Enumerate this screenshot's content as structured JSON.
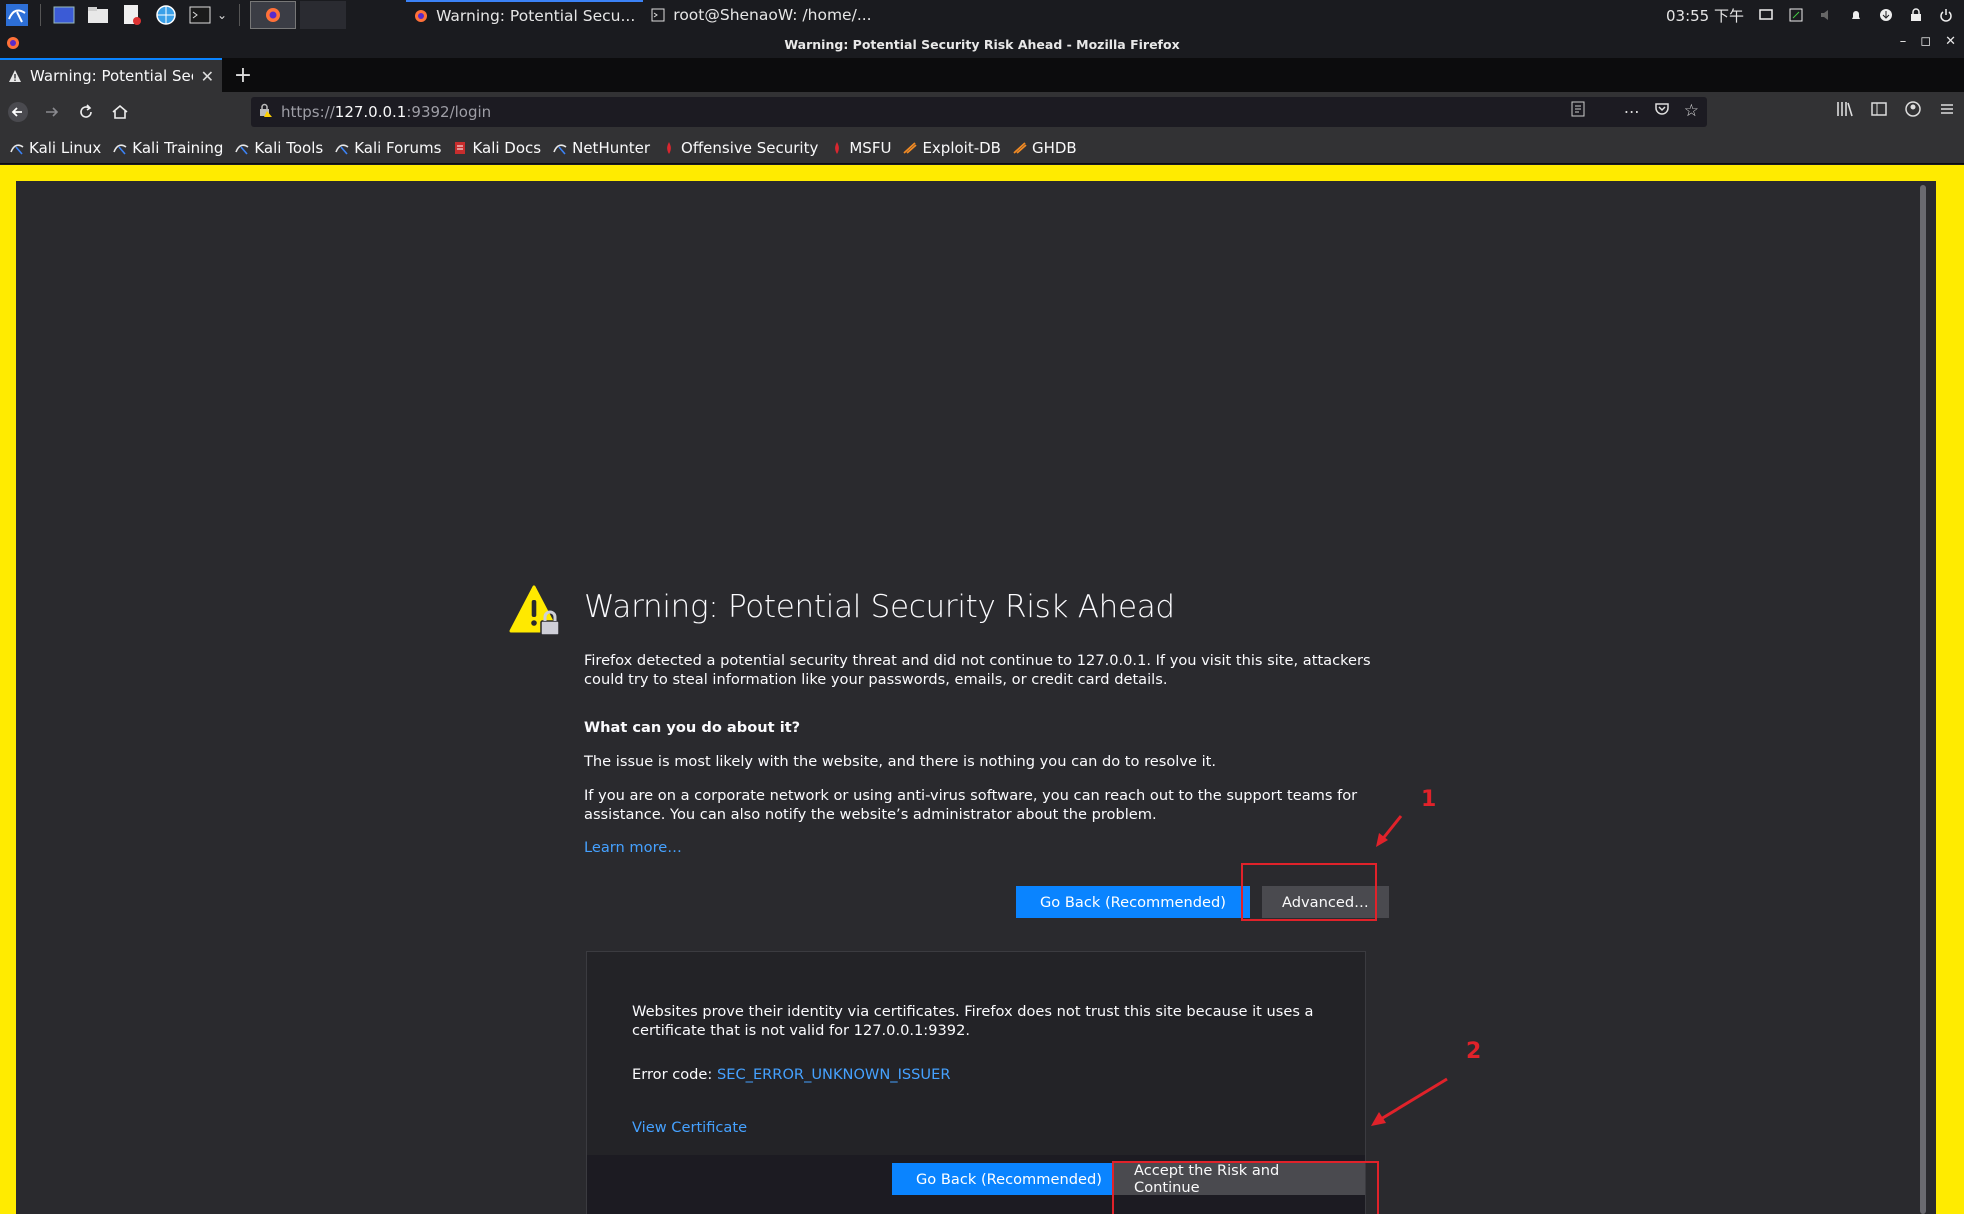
{
  "os_panel": {
    "taskbar_windows": [
      {
        "label": "Warning: Potential Secu...",
        "icon": "firefox-icon"
      },
      {
        "label": "root@ShenaoW: /home/...",
        "icon": "terminal-icon"
      }
    ],
    "clock": "03:55 下午"
  },
  "window": {
    "title": "Warning: Potential Security Risk Ahead - Mozilla Firefox"
  },
  "tabs": [
    {
      "title": "Warning: Potential Security Risk Ahead"
    }
  ],
  "url": {
    "scheme": "https://",
    "host": "127.0.0.1",
    "rest": ":9392/login"
  },
  "bookmarks": [
    {
      "label": "Kali Linux",
      "icon": "kali-icon"
    },
    {
      "label": "Kali Training",
      "icon": "kali-icon"
    },
    {
      "label": "Kali Tools",
      "icon": "kali-icon"
    },
    {
      "label": "Kali Forums",
      "icon": "kali-icon"
    },
    {
      "label": "Kali Docs",
      "icon": "kali-docs-icon"
    },
    {
      "label": "NetHunter",
      "icon": "kali-icon"
    },
    {
      "label": "Offensive Security",
      "icon": "offsec-icon"
    },
    {
      "label": "MSFU",
      "icon": "offsec-icon"
    },
    {
      "label": "Exploit-DB",
      "icon": "exploitdb-icon"
    },
    {
      "label": "GHDB",
      "icon": "exploitdb-icon"
    }
  ],
  "error_page": {
    "title": "Warning: Potential Security Risk Ahead",
    "detected": "Firefox detected a potential security threat and did not continue to 127.0.0.1. If you visit this site, attackers could try to steal information like your passwords, emails, or credit card details.",
    "what_heading": "What can you do about it?",
    "issue": "The issue is most likely with the website, and there is nothing you can do to resolve it.",
    "corporate": "If you are on a corporate network or using anti-virus software, you can reach out to the support teams for assistance. You can also notify the website’s administrator about the problem.",
    "learn_more": "Learn more…",
    "go_back": "Go Back (Recommended)",
    "advanced": "Advanced…",
    "advanced_panel": {
      "text": "Websites prove their identity via certificates. Firefox does not trust this site because it uses a certificate that is not valid for 127.0.0.1:9392.",
      "error_label": "Error code: ",
      "error_code": "SEC_ERROR_UNKNOWN_ISSUER",
      "view_certificate": "View Certificate",
      "go_back": "Go Back (Recommended)",
      "accept": "Accept the Risk and Continue"
    }
  },
  "annotations": {
    "step1": "1",
    "step2": "2"
  },
  "colors": {
    "highlight_border": "#ffeb00",
    "annotation_red": "#e0222a",
    "primary_blue": "#0a84ff",
    "link_blue": "#45a1ff"
  }
}
